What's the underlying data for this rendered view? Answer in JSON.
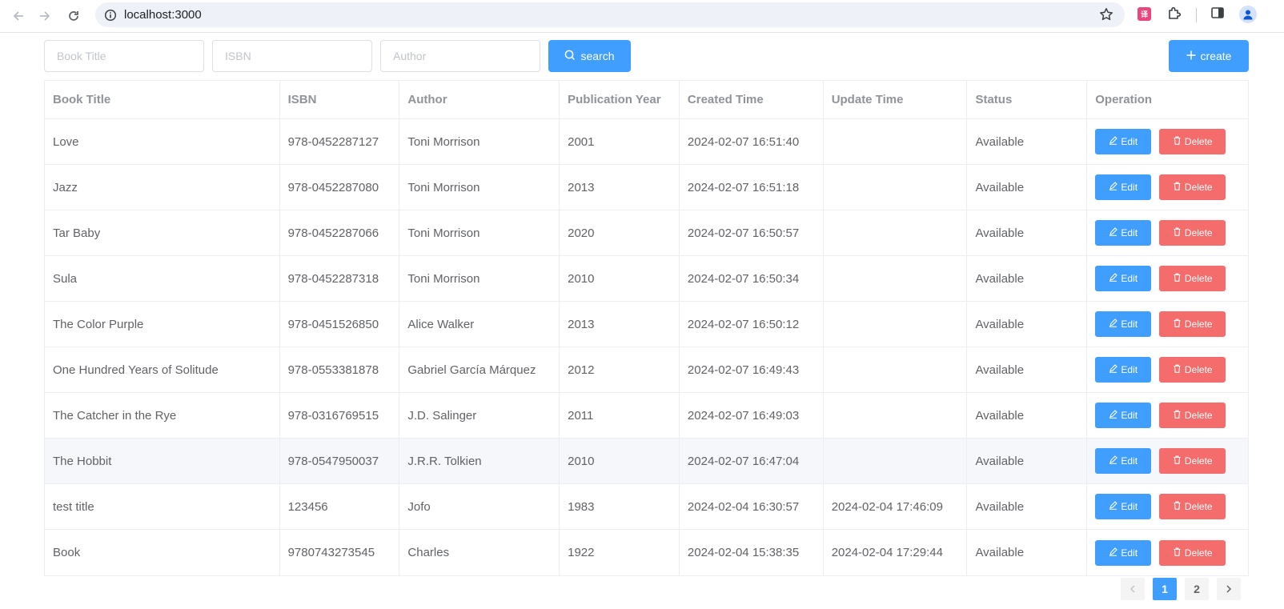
{
  "browser": {
    "url": "localhost:3000",
    "translate_label": "译"
  },
  "toolbar": {
    "title_placeholder": "Book Title",
    "isbn_placeholder": "ISBN",
    "author_placeholder": "Author",
    "search_label": "search",
    "create_label": "create"
  },
  "table": {
    "columns": [
      "Book Title",
      "ISBN",
      "Author",
      "Publication Year",
      "Created Time",
      "Update Time",
      "Status",
      "Operation"
    ],
    "rows": [
      {
        "title": "Love",
        "isbn": "978-0452287127",
        "author": "Toni Morrison",
        "year": "2001",
        "created": "2024-02-07 16:51:40",
        "updated": "",
        "status": "Available"
      },
      {
        "title": "Jazz",
        "isbn": "978-0452287080",
        "author": "Toni Morrison",
        "year": "2013",
        "created": "2024-02-07 16:51:18",
        "updated": "",
        "status": "Available"
      },
      {
        "title": "Tar Baby",
        "isbn": "978-0452287066",
        "author": "Toni Morrison",
        "year": "2020",
        "created": "2024-02-07 16:50:57",
        "updated": "",
        "status": "Available"
      },
      {
        "title": "Sula",
        "isbn": "978-0452287318",
        "author": "Toni Morrison",
        "year": "2010",
        "created": "2024-02-07 16:50:34",
        "updated": "",
        "status": "Available"
      },
      {
        "title": "The Color Purple",
        "isbn": "978-0451526850",
        "author": "Alice Walker",
        "year": "2013",
        "created": "2024-02-07 16:50:12",
        "updated": "",
        "status": "Available"
      },
      {
        "title": "One Hundred Years of Solitude",
        "isbn": "978-0553381878",
        "author": "Gabriel García Márquez",
        "year": "2012",
        "created": "2024-02-07 16:49:43",
        "updated": "",
        "status": "Available"
      },
      {
        "title": "The Catcher in the Rye",
        "isbn": "978-0316769515",
        "author": "J.D. Salinger",
        "year": "2011",
        "created": "2024-02-07 16:49:03",
        "updated": "",
        "status": "Available"
      },
      {
        "title": "The Hobbit",
        "isbn": "978-0547950037",
        "author": "J.R.R. Tolkien",
        "year": "2010",
        "created": "2024-02-07 16:47:04",
        "updated": "",
        "status": "Available"
      },
      {
        "title": "test title",
        "isbn": "123456",
        "author": "Jofo",
        "year": "1983",
        "created": "2024-02-04 16:30:57",
        "updated": "2024-02-04 17:46:09",
        "status": "Available"
      },
      {
        "title": "Book",
        "isbn": "9780743273545",
        "author": "Charles",
        "year": "1922",
        "created": "2024-02-04 15:38:35",
        "updated": "2024-02-04 17:29:44",
        "status": "Available"
      }
    ],
    "edit_label": "Edit",
    "delete_label": "Delete",
    "hovered_row": 7
  },
  "pagination": {
    "pages": [
      "1",
      "2"
    ],
    "current": "1"
  },
  "colors": {
    "primary": "#409eff",
    "danger": "#f56c6c"
  }
}
